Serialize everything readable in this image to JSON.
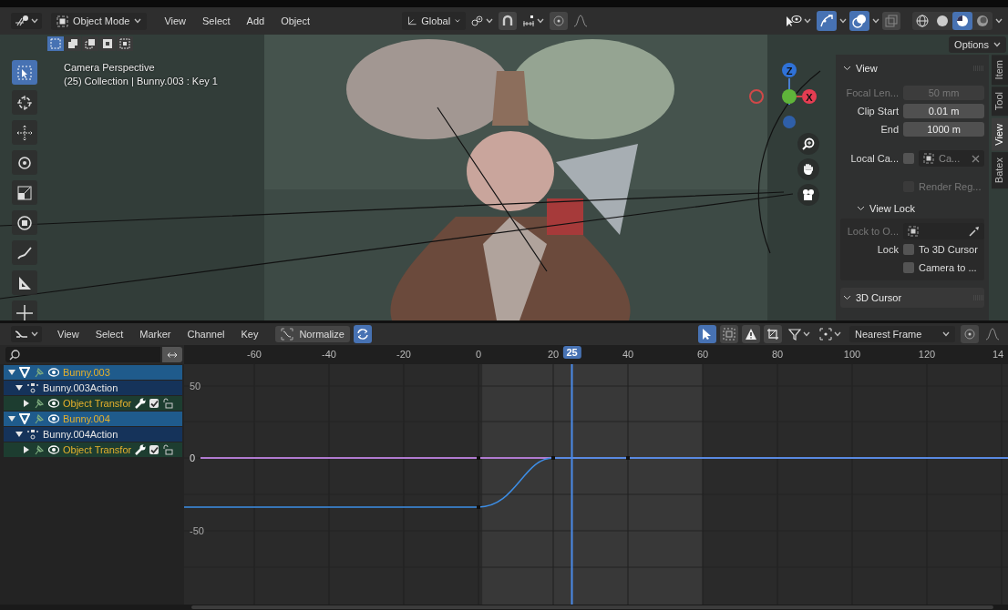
{
  "viewport_header": {
    "mode": "Object Mode",
    "menus": [
      "View",
      "Select",
      "Add",
      "Object"
    ],
    "orientation": "Global",
    "snap_on": false,
    "proportional_on": false,
    "gizmos_on": true,
    "overlays_on": true,
    "xray_on": false,
    "shading": [
      {
        "selected": false
      },
      {
        "selected": false
      },
      {
        "selected": true
      },
      {
        "selected": false
      }
    ]
  },
  "select_modes": [
    {
      "selected": true
    },
    {
      "selected": false
    },
    {
      "selected": false
    },
    {
      "selected": false
    },
    {
      "selected": false
    }
  ],
  "options_button": "Options",
  "viewport": {
    "camera_label": "Camera Perspective",
    "object_label": "(25) Collection | Bunny.003 : Key 1"
  },
  "tools": [
    {
      "kind": "select",
      "selected": true
    },
    {
      "kind": "cursor",
      "selected": false
    },
    {
      "kind": "move",
      "selected": false
    },
    {
      "kind": "rotate",
      "selected": false
    },
    {
      "kind": "scale",
      "selected": false
    },
    {
      "kind": "transform",
      "selected": false
    },
    {
      "kind": "annotate",
      "selected": false
    },
    {
      "kind": "measure",
      "selected": false
    },
    {
      "kind": "add",
      "selected": false
    }
  ],
  "gizmo": {
    "z_label": "Z",
    "x_label": "X"
  },
  "sidebar": {
    "tabs": [
      {
        "label": "Item",
        "selected": false
      },
      {
        "label": "Tool",
        "selected": false
      },
      {
        "label": "View",
        "selected": true
      },
      {
        "label": "Batex",
        "selected": false
      }
    ],
    "view_panel": {
      "title": "View",
      "fields": [
        {
          "label": "Focal Len...",
          "value": "50 mm",
          "disabled": true
        },
        {
          "label": "Clip Start",
          "value": "0.01 m",
          "disabled": false
        },
        {
          "label": "End",
          "value": "1000 m",
          "disabled": false
        }
      ],
      "local_camera": {
        "label": "Local Ca...",
        "checked": false,
        "value": "Ca..."
      },
      "render_region": {
        "label": "Render Reg...",
        "checked": false,
        "disabled": true
      },
      "view_lock": {
        "title": "View Lock",
        "lock_to": {
          "label": "Lock to O...",
          "disabled": true
        },
        "lock_label": "Lock",
        "options": [
          {
            "label": "To 3D Cursor",
            "checked": false
          },
          {
            "label": "Camera to ...",
            "checked": false
          }
        ]
      }
    },
    "cursor_panel": {
      "title": "3D Cursor"
    }
  },
  "graph_header": {
    "menus": [
      "View",
      "Select",
      "Marker",
      "Channel",
      "Key"
    ],
    "normalize": {
      "label": "Normalize",
      "on": false
    },
    "auto_normalize_on": true,
    "only_selected_on": true,
    "show_hidden_on": false,
    "only_errors_on": false,
    "snapping": "Nearest Frame",
    "proportional_on": false
  },
  "ruler": {
    "ticks": [
      "-60",
      "-40",
      "-20",
      "0",
      "20",
      "40",
      "60",
      "80",
      "100",
      "120",
      "14"
    ],
    "current_frame": "25"
  },
  "channels": [
    {
      "kind": "object",
      "name": "Bunny.003",
      "expanded": true,
      "children": [
        {
          "kind": "action",
          "name": "Bunny.003Action",
          "expanded": true,
          "children": [
            {
              "kind": "group",
              "name": "Object Transfor",
              "expanded": false,
              "checked": true
            }
          ]
        }
      ]
    },
    {
      "kind": "object",
      "name": "Bunny.004",
      "expanded": true,
      "children": [
        {
          "kind": "action",
          "name": "Bunny.004Action",
          "expanded": true,
          "children": [
            {
              "kind": "group",
              "name": "Object Transfor",
              "expanded": false,
              "checked": true
            }
          ]
        }
      ]
    }
  ],
  "graph": {
    "y_labels": [
      "50",
      "0",
      "-50"
    ]
  }
}
